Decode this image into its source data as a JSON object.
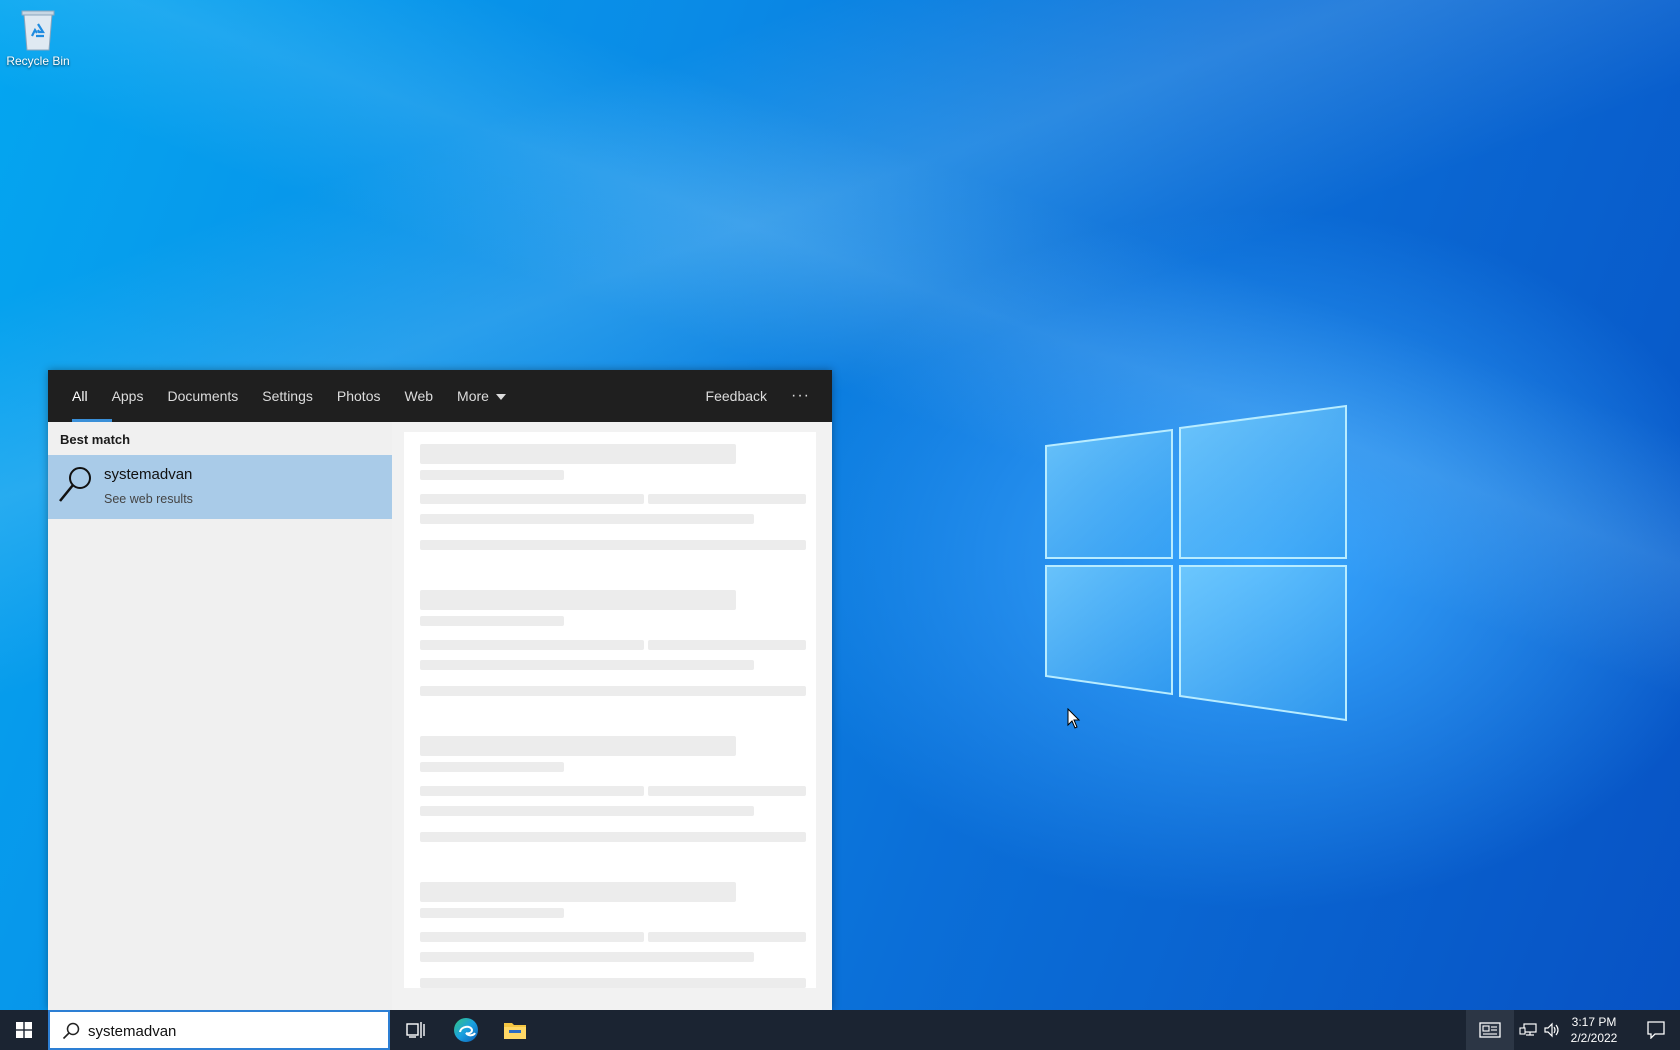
{
  "desktop": {
    "recycle_bin_label": "Recycle Bin"
  },
  "search_flyout": {
    "tabs": [
      {
        "label": "All",
        "active": true
      },
      {
        "label": "Apps"
      },
      {
        "label": "Documents"
      },
      {
        "label": "Settings"
      },
      {
        "label": "Photos"
      },
      {
        "label": "Web"
      },
      {
        "label": "More"
      }
    ],
    "feedback_label": "Feedback",
    "more_options_label": "···",
    "best_match_heading": "Best match",
    "best_match": {
      "title": "systemadvan",
      "subtitle": "See web results",
      "icon": "search-icon"
    }
  },
  "taskbar": {
    "search_value": "systemadvan",
    "clock_time": "3:17 PM",
    "clock_date": "2/2/2022",
    "icons": [
      "windows-start-icon",
      "task-view-icon",
      "edge-icon",
      "file-explorer-icon",
      "news-icon",
      "network-icon",
      "volume-icon",
      "notification-icon"
    ]
  },
  "colors": {
    "accent": "#3a8fd8",
    "selection": "#a9cbe8",
    "taskbar": "#1b2432",
    "flyout_header": "#1f1f1f"
  }
}
